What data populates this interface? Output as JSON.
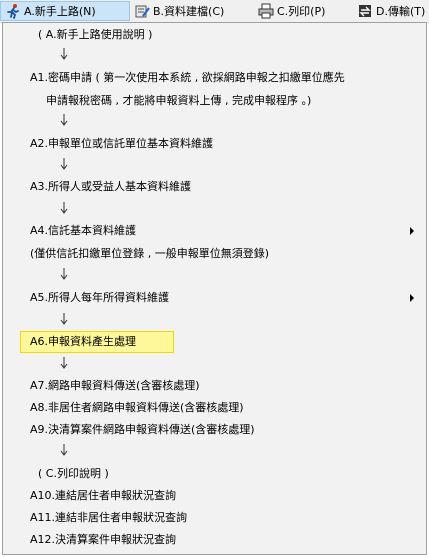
{
  "menubar": {
    "items": [
      {
        "label": "A.新手上路(N)",
        "icon": "person-run-icon"
      },
      {
        "label": "B.資料建檔(C)",
        "icon": "database-edit-icon"
      },
      {
        "label": "C.列印(P)",
        "icon": "printer-icon"
      },
      {
        "label": "D.傳輸(T)",
        "icon": "transfer-icon"
      }
    ]
  },
  "menu": {
    "section_a": "( A.新手上路使用說明 )",
    "a1_line1": "A1.密碼申請 ( 第一次使用本系統 , 欲採網路申報之扣繳單位應先",
    "a1_line2": "申請報稅密碼 , 才能將申報資料上傳 , 完成申報程序 。)",
    "a2": "A2.申報單位或信託單位基本資料維護",
    "a3": "A3.所得人或受益人基本資料維護",
    "a4": "A4.信託基本資料維護",
    "a4_note": "(僅供信託扣繳單位登錄 , 一般申報單位無須登錄)",
    "a5": "A5.所得人每年所得資料維護",
    "a6": "A6.申報資料產生處理",
    "a7": "A7.網路申報資料傳送(含審核處理)",
    "a8": "A8.非居住者網路申報資料傳送(含審核處理)",
    "a9": "A9.決清算案件網路申報資料傳送(含審核處理)",
    "section_c": "( C.列印說明 )",
    "a10": "A10.連結居住者申報狀況查詢",
    "a11": "A11.連結非居住者申報狀況查詢",
    "a12": "A12.決清算案件申報狀況查詢"
  },
  "colors": {
    "highlight": "#fff89a",
    "active_menu": "#cce4f7"
  }
}
